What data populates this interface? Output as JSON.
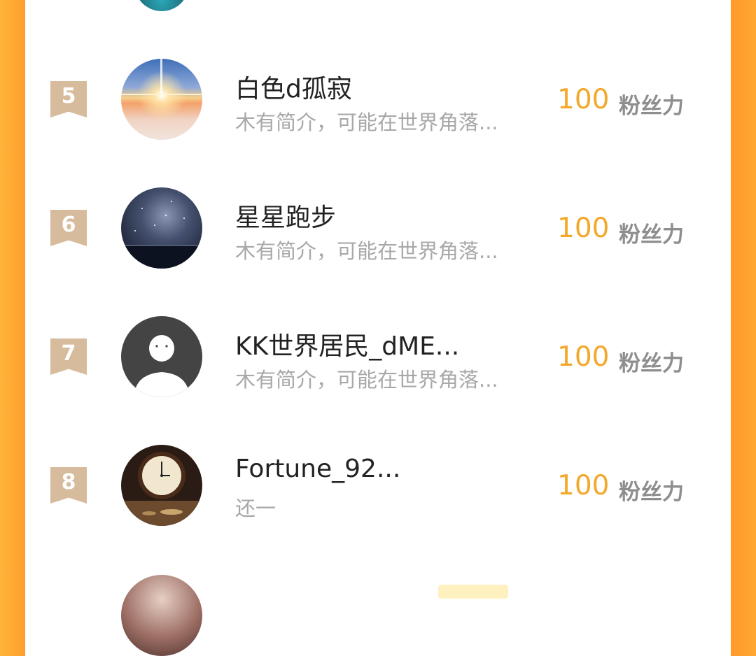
{
  "ranking": {
    "items": [
      {
        "rank": "5",
        "name": "白色d孤寂",
        "intro": "木有简介，可能在世界角落...",
        "fans_value": "100",
        "fans_label": "粉丝力",
        "avatar": "sunset-sky-avatar"
      },
      {
        "rank": "6",
        "name": "星星跑步",
        "intro": "木有简介，可能在世界角落...",
        "fans_value": "100",
        "fans_label": "粉丝力",
        "avatar": "starry-night-avatar"
      },
      {
        "rank": "7",
        "name": "KK世界居民_dME...",
        "intro": "木有简介，可能在世界角落...",
        "fans_value": "100",
        "fans_label": "粉丝力",
        "avatar": "default-user-avatar"
      },
      {
        "rank": "8",
        "name": "Fortune_92...",
        "intro": "还一",
        "fans_value": "100",
        "fans_label": "粉丝力",
        "avatar": "clock-avatar"
      }
    ]
  },
  "colors": {
    "accent": "#f4a82b",
    "frame_orange": "#ffa632",
    "badge": "#d6bb9c"
  }
}
